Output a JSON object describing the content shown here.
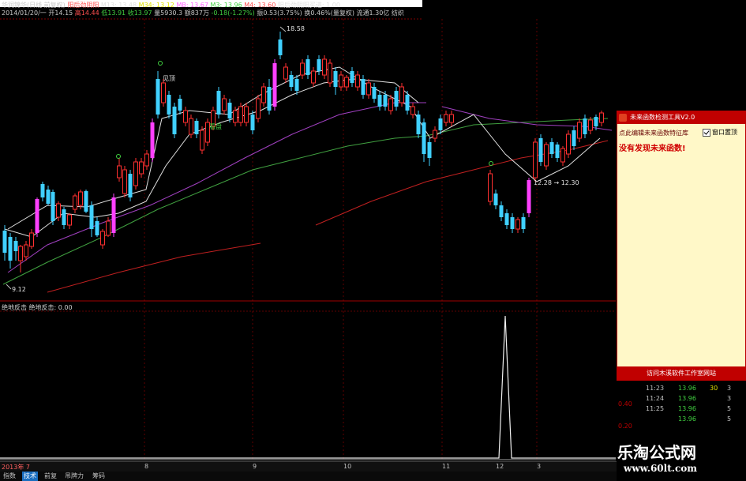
{
  "header": {
    "line1": {
      "name": "华润锦华(日线 前复权)",
      "title": "阳后劲阴阳",
      "ma13": "M13: 13.48",
      "ma34": "M34: 13.12",
      "mb": "MB: 13.67",
      "m3": "M3: 13.96",
      "m4": "M4: 13.60",
      "right_title": "阳后劲阴阳买进: 1.00"
    },
    "line2": {
      "date": "2014/01/20/一 开14.15",
      "high": "高14.44",
      "low": "低13.91",
      "close": "收13.97",
      "vol": "量5930.3",
      "amount": "额837万",
      "change": "-0.18(-1.27%)",
      "amp": "振0.53(3.75%)",
      "turnover": "换0.46%(量复权)",
      "float": "流通1.30亿 纺织"
    }
  },
  "annotations": {
    "high_price": "18.58",
    "low_price": "9.12",
    "signal1": "见顶",
    "signal2": "看盘",
    "range_label": "12.28 → 12.30"
  },
  "subchart": {
    "label": "绝地反击 绝地反击: 0.00"
  },
  "panel": {
    "title": "未来函数检测工具V2.0",
    "hint": "点此编辑未来函数特征库",
    "checkbox_label": "窗口置顶",
    "checked": true,
    "message": "没有发现未来函数!",
    "footer_button": "访问木溪软件工作室网站"
  },
  "trades": [
    {
      "time": "11:23",
      "price": "13.96",
      "vol": "30",
      "dir": "3"
    },
    {
      "time": "11:24",
      "price": "13.96",
      "vol": "",
      "dir": "3"
    },
    {
      "time": "11:25",
      "price": "13.96",
      "vol": "",
      "dir": "5"
    },
    {
      "time": "",
      "price": "13.96",
      "vol": "",
      "dir": "5"
    }
  ],
  "trade_axis": [
    "0.40",
    "0.20"
  ],
  "x_axis": [
    "2013年 7",
    "8",
    "9",
    "10",
    "11",
    "12",
    "3"
  ],
  "tabs": [
    "指数",
    "技术",
    "前复",
    "吊牌力",
    "筹码"
  ],
  "active_tab": 1,
  "watermark": {
    "cn": "乐淘公式网",
    "url": "www.60lt.com"
  },
  "colors": {
    "up": "#ff40ff",
    "down": "#40d0ff",
    "ma_white": "#e0e0e0",
    "ma_purple": "#a040c0",
    "ma_green": "#40a040",
    "ma_red": "#c02020"
  }
}
